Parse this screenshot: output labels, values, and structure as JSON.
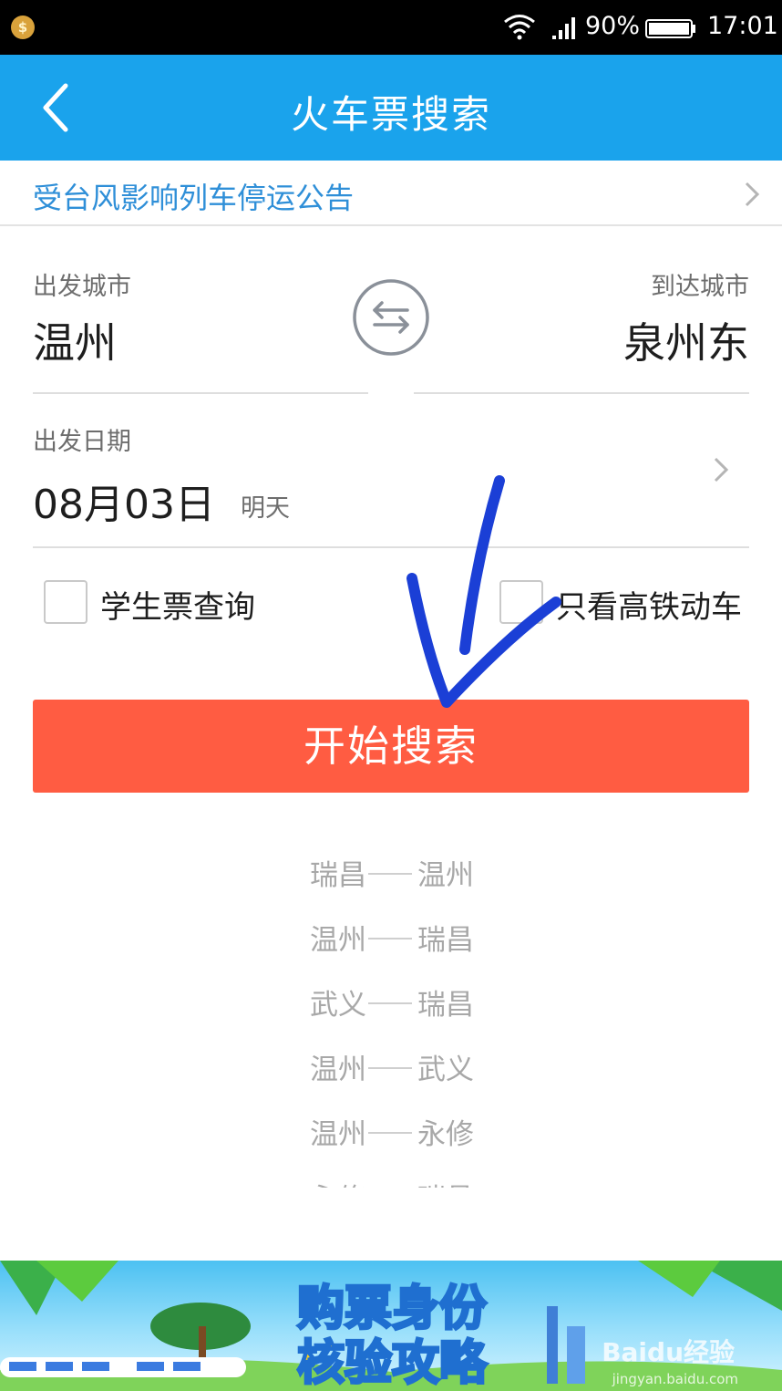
{
  "status_bar": {
    "app_badge": "$",
    "battery_percent": "90%",
    "time": "17:01"
  },
  "header": {
    "title": "火车票搜索"
  },
  "notice": {
    "text": "受台风影响列车停运公告"
  },
  "route": {
    "from_label": "出发城市",
    "from_city": "温州",
    "to_label": "到达城市",
    "to_city": "泉州东"
  },
  "date": {
    "label": "出发日期",
    "value": "08月03日",
    "hint": "明天"
  },
  "options": {
    "student_label": "学生票查询",
    "gd_only_label": "只看高铁动车"
  },
  "search_button_label": "开始搜索",
  "history": [
    {
      "from": "瑞昌",
      "to": "温州"
    },
    {
      "from": "温州",
      "to": "瑞昌"
    },
    {
      "from": "武义",
      "to": "瑞昌"
    },
    {
      "from": "温州",
      "to": "武义"
    },
    {
      "from": "温州",
      "to": "永修"
    },
    {
      "from": "永修",
      "to": "瑞昌"
    }
  ],
  "banner": {
    "line1": "购票身份",
    "line2": "核验攻略"
  },
  "watermark": {
    "brand": "Baidu经验",
    "url": "jingyan.baidu.com"
  },
  "colors": {
    "header_bg": "#1aa3ec",
    "notice_text": "#2f8fd8",
    "search_button": "#ff5c42",
    "annotation_ink": "#1b3fd6"
  },
  "icons": {
    "back": "chevron-left-icon",
    "swap": "swap-arrows-icon",
    "notice_chevron": "chevron-right-icon",
    "date_chevron": "chevron-right-icon"
  }
}
